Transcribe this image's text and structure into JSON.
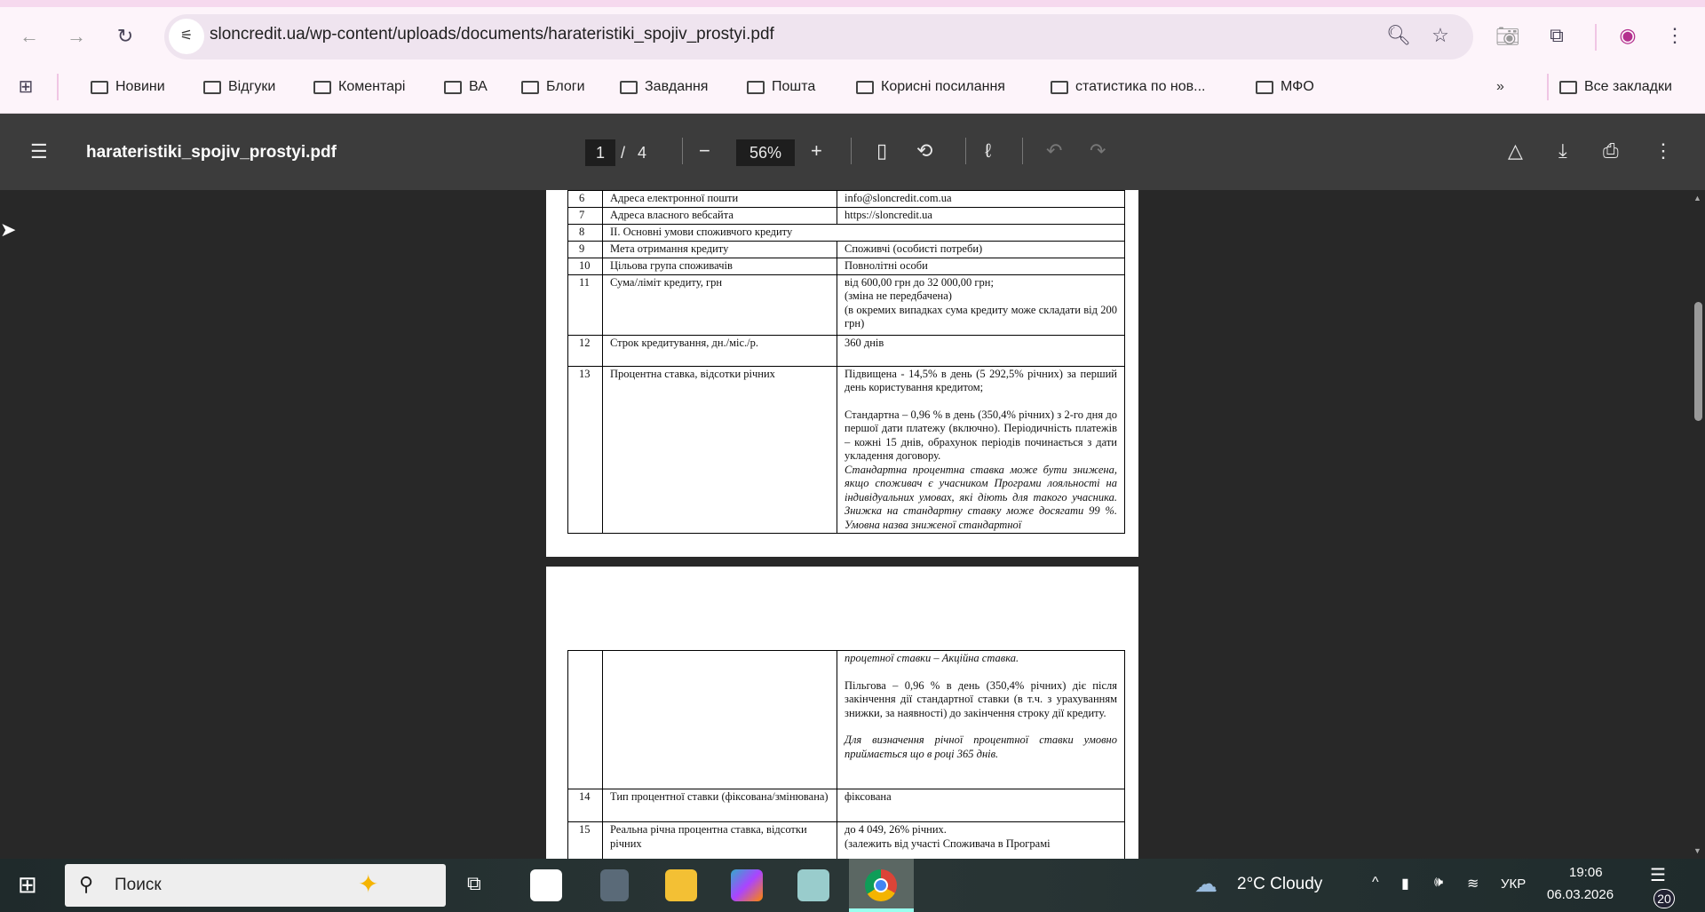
{
  "browser": {
    "url": "sloncredit.ua/wp-content/uploads/documents/harateristiki_spojiv_prostyi.pdf",
    "bookmarks": [
      "Новини",
      "Відгуки",
      "Коментарі",
      "ВА",
      "Блоги",
      "Завдання",
      "Пошта",
      "Корисні посилання",
      "статистика по нов...",
      "МФО"
    ],
    "more_bookmarks": "»",
    "all_bookmarks": "Все закладки",
    "accent": "#b4308e"
  },
  "pdf_toolbar": {
    "title": "harateristiki_spojiv_prostyi.pdf",
    "current_page": "1",
    "separator": "/",
    "total_pages": "4",
    "zoom": "56%"
  },
  "page1_rows": [
    {
      "num": "6",
      "label": "Адреса електронної пошти",
      "value": [
        {
          "t": "info@sloncredit.com.ua"
        }
      ]
    },
    {
      "num": "7",
      "label": "Адреса власного вебсайта",
      "value": [
        {
          "t": "https://sloncredit.ua"
        }
      ]
    },
    {
      "num": "8",
      "label": "II. Основні умови споживчого кредиту",
      "span": true
    },
    {
      "num": "9",
      "label": "Мета отримання кредиту",
      "value": [
        {
          "t": "Споживчі (особисті потреби)"
        }
      ]
    },
    {
      "num": "10",
      "label": "Цільова група споживачів",
      "value": [
        {
          "t": "Повнолітні особи"
        }
      ]
    },
    {
      "num": "11",
      "label": "Сума/ліміт кредиту, грн",
      "value": [
        {
          "t": "від 600,00 грн до 32 000,00 грн;"
        },
        {
          "t": "(зміна не передбачена)"
        },
        {
          "t": "(в окремих випадках сума кредиту може складати від 200 грн)"
        }
      ]
    },
    {
      "num": "12",
      "label": "Строк кредитування, дн./міс./р.",
      "value": [
        {
          "t": "360 днів"
        }
      ]
    },
    {
      "num": "13",
      "label": "Процентна ставка, відсотки річних",
      "value": [
        {
          "t": "Підвищена - 14,5% в день  (5 292,5% річних) за перший день користування кредитом;"
        },
        {
          "t": "Стандартна – 0,96 % в день (350,4% річних)  з 2-го дня до першої дати платежу (включно). Періодичність платежів – кожні 15 днів, обрахунок періодів починається  з дати укладення договору.",
          "gap": true
        },
        {
          "t": "Стандартна процентна ставка може бути знижена, якщо споживач є учасником Програми лояльності на індивідуальних  умовах, які діють для такого учасника. Знижка на стандартну ставку може досягати 99 %. Умовна назва зниженої стандартної",
          "it": true
        }
      ]
    }
  ],
  "page2_rows": [
    {
      "num": "",
      "label": "",
      "value": [
        {
          "t": "процетної ставки – Акційна ставка.",
          "it": true
        },
        {
          "t": "Пільгова – 0,96 % в день (350,4% річних)  діє після закінчення дії стандартної ставки (в т.ч. з урахуванням знижки, за наявності)  до закінчення строку дії кредиту.",
          "gap": true
        },
        {
          "t": "Для визначення річної процентної ставки умовно приймається що в році 365 днів.",
          "it": true,
          "gap": true
        }
      ]
    },
    {
      "num": "14",
      "label": "Тип процентної ставки (фіксована/змінювана)",
      "value": [
        {
          "t": "фіксована"
        }
      ]
    },
    {
      "num": "15",
      "label": "Реальна річна процентна ставка, відсотки річних",
      "value": [
        {
          "t": "до 4 049, 26%  річних."
        },
        {
          "t": "(залежить від участі Споживача в Програмі"
        }
      ]
    }
  ],
  "taskbar": {
    "search_placeholder": "Поиск",
    "weather": "2°C  Cloudy",
    "language": "УКР",
    "time": "19:06",
    "date": "06.03.2026",
    "notifications": "20"
  }
}
